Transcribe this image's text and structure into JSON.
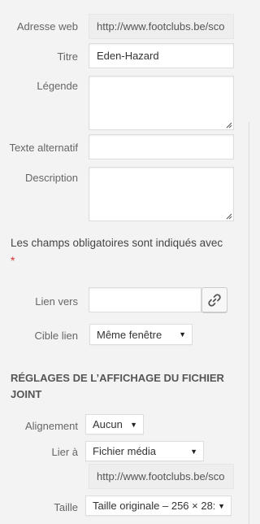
{
  "attachment_details": {
    "url": {
      "label": "Adresse web",
      "value": "http://www.footclubs.be/sco"
    },
    "title": {
      "label": "Titre",
      "value": "Eden-Hazard"
    },
    "caption": {
      "label": "Légende",
      "value": ""
    },
    "alt_text": {
      "label": "Texte alternatif",
      "value": ""
    },
    "description": {
      "label": "Description",
      "value": ""
    }
  },
  "required_note": {
    "text": "Les champs obligatoires sont indiqués avec",
    "marker": "*"
  },
  "link": {
    "link_to": {
      "label": "Lien vers",
      "value": "",
      "button_icon": "link-icon"
    },
    "target": {
      "label": "Cible lien",
      "selected": "Même fenêtre"
    }
  },
  "display_settings": {
    "heading": "Réglages de l’affichage du fichier joint",
    "alignment": {
      "label": "Alignement",
      "selected": "Aucun"
    },
    "link_to": {
      "label": "Lier à",
      "selected": "Fichier média",
      "url": "http://www.footclubs.be/sco"
    },
    "size": {
      "label": "Taille",
      "selected": "Taille originale – 256 × 28:"
    }
  },
  "colors": {
    "background": "#f3f3f3",
    "required": "#dc3232",
    "readonly_field": "#eeeeee"
  }
}
